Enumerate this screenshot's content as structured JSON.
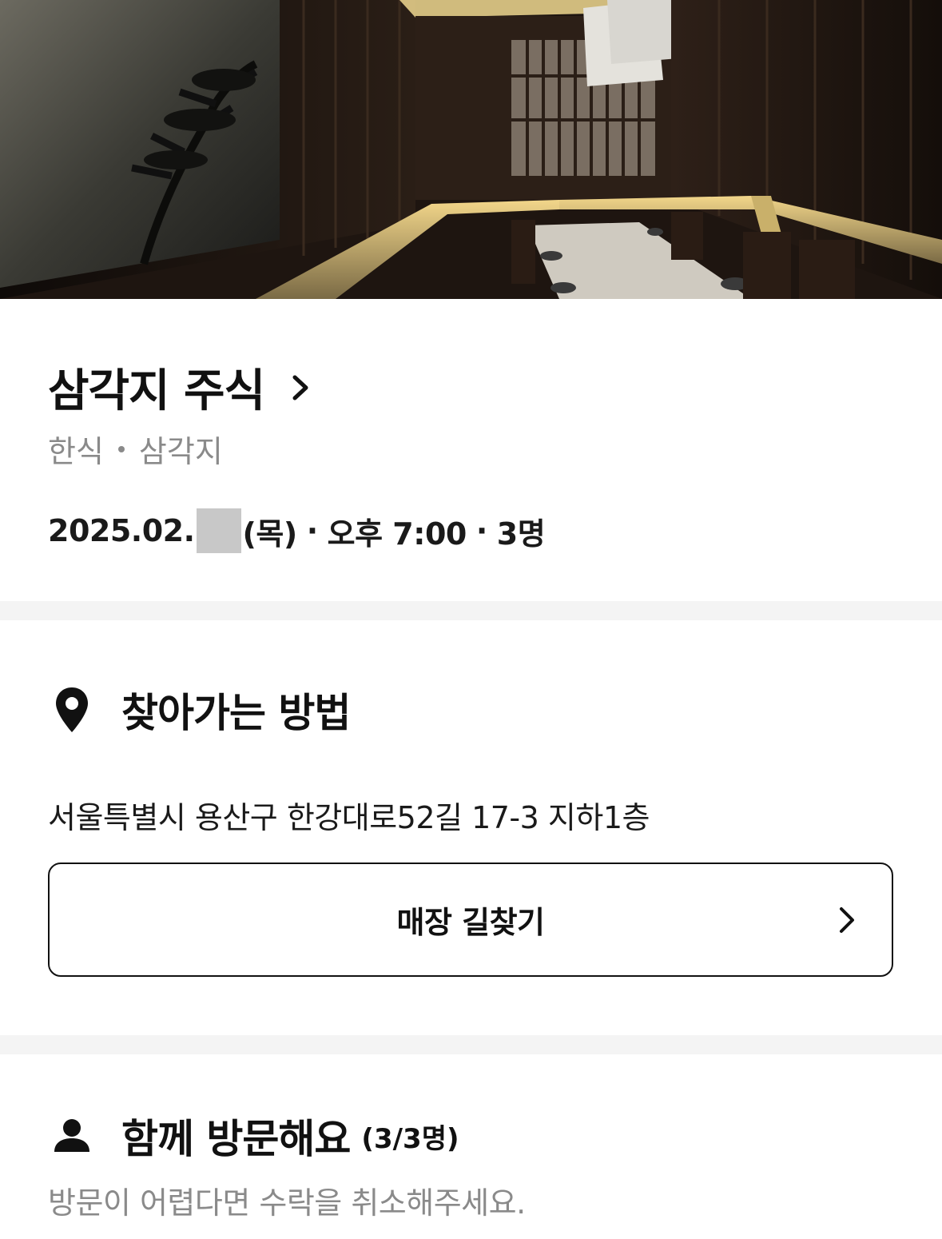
{
  "hero": {
    "image_alt": ""
  },
  "restaurant": {
    "name": "삼각지 주식",
    "cuisine": "한식",
    "area": "삼각지"
  },
  "booking": {
    "date_prefix": "2025.02.",
    "date_suffix": "(목)",
    "separator": "·",
    "time": "오후 7:00",
    "party": "3명"
  },
  "directions": {
    "icon": "location-pin-icon",
    "title": "찾아가는 방법",
    "address": "서울특별시 용산구 한강대로52길 17-3 지하1층",
    "route_button_label": "매장 길찾기"
  },
  "companions": {
    "icon": "person-icon",
    "title": "함께 방문해요",
    "count": "(3/3명)",
    "guide_text": "방문이 어렵다면 수락을 취소해주세요."
  },
  "colors": {
    "text_primary": "#111111",
    "text_secondary": "#8a8a8a",
    "divider": "#f4f4f4",
    "redaction": "#c8c8c8"
  }
}
